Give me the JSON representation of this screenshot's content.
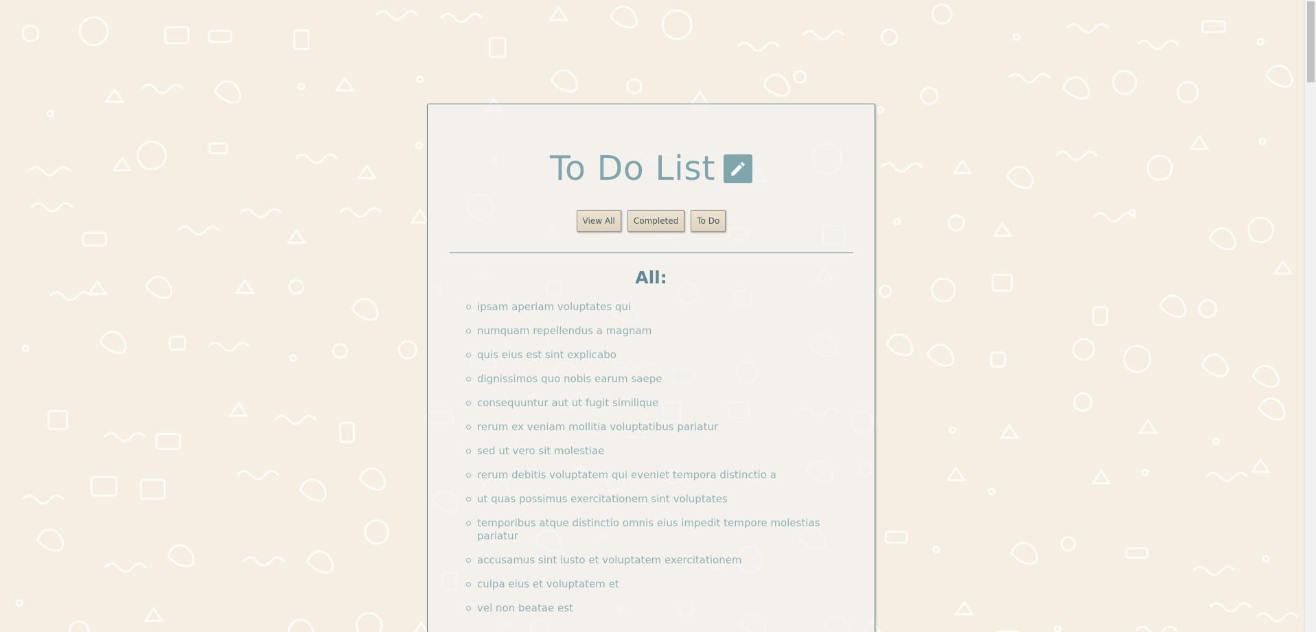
{
  "app": {
    "title": "To Do List",
    "edit_icon": "pencil-icon"
  },
  "filters": {
    "view_all_label": "View All",
    "completed_label": "Completed",
    "todo_label": "To Do"
  },
  "list": {
    "heading": "All:",
    "items": [
      "ipsam aperiam voluptates qui",
      "numquam repellendus a magnam",
      "quis eius est sint explicabo",
      "dignissimos quo nobis earum saepe",
      "consequuntur aut ut fugit similique",
      "rerum ex veniam mollitia voluptatibus pariatur",
      "sed ut vero sit molestiae",
      "rerum debitis voluptatem qui eveniet tempora distinctio a",
      "ut quas possimus exercitationem sint voluptates",
      "temporibus atque distinctio omnis eius impedit tempore molestias pariatur",
      "accusamus sint iusto et voluptatem exercitationem",
      "culpa eius et voluptatem et",
      "vel non beatae est"
    ]
  },
  "colors": {
    "page_background": "#f5eee2",
    "accent": "#7fa6ac",
    "item_text": "#8fb2b7",
    "heading_text": "#5f8990",
    "card_border": "#5e7b82",
    "button_background": "#e8ddc9"
  }
}
